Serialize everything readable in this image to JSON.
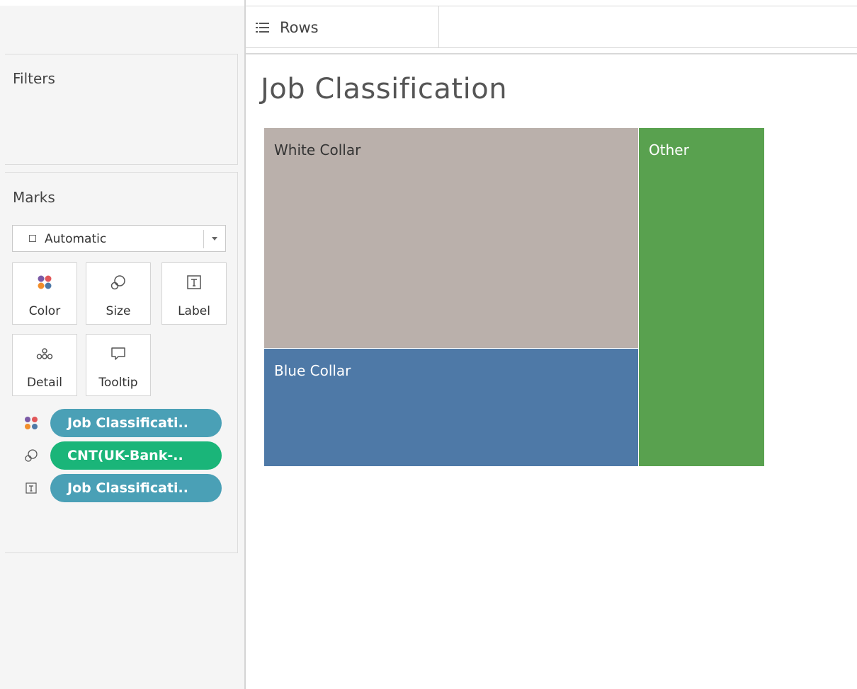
{
  "shelves": {
    "rows_label": "Rows"
  },
  "filters": {
    "title": "Filters"
  },
  "marks": {
    "title": "Marks",
    "mark_type": "Automatic",
    "buttons": [
      "Color",
      "Size",
      "Label",
      "Detail",
      "Tooltip"
    ],
    "fields": [
      {
        "role": "color",
        "label": "Job Classificati..",
        "color": "#4aa0b6"
      },
      {
        "role": "size",
        "label": "CNT(UK-Bank-..",
        "color": "#1ab579"
      },
      {
        "role": "label",
        "label": "Job Classificati..",
        "color": "#4aa0b6"
      }
    ]
  },
  "view": {
    "title": "Job Classification"
  },
  "chart_data": {
    "type": "treemap",
    "title": "Job Classification",
    "items": [
      {
        "label": "White Collar",
        "color": "#bab0ab"
      },
      {
        "label": "Blue Collar",
        "color": "#4e79a7"
      },
      {
        "label": "Other",
        "color": "#59a14f"
      }
    ]
  }
}
